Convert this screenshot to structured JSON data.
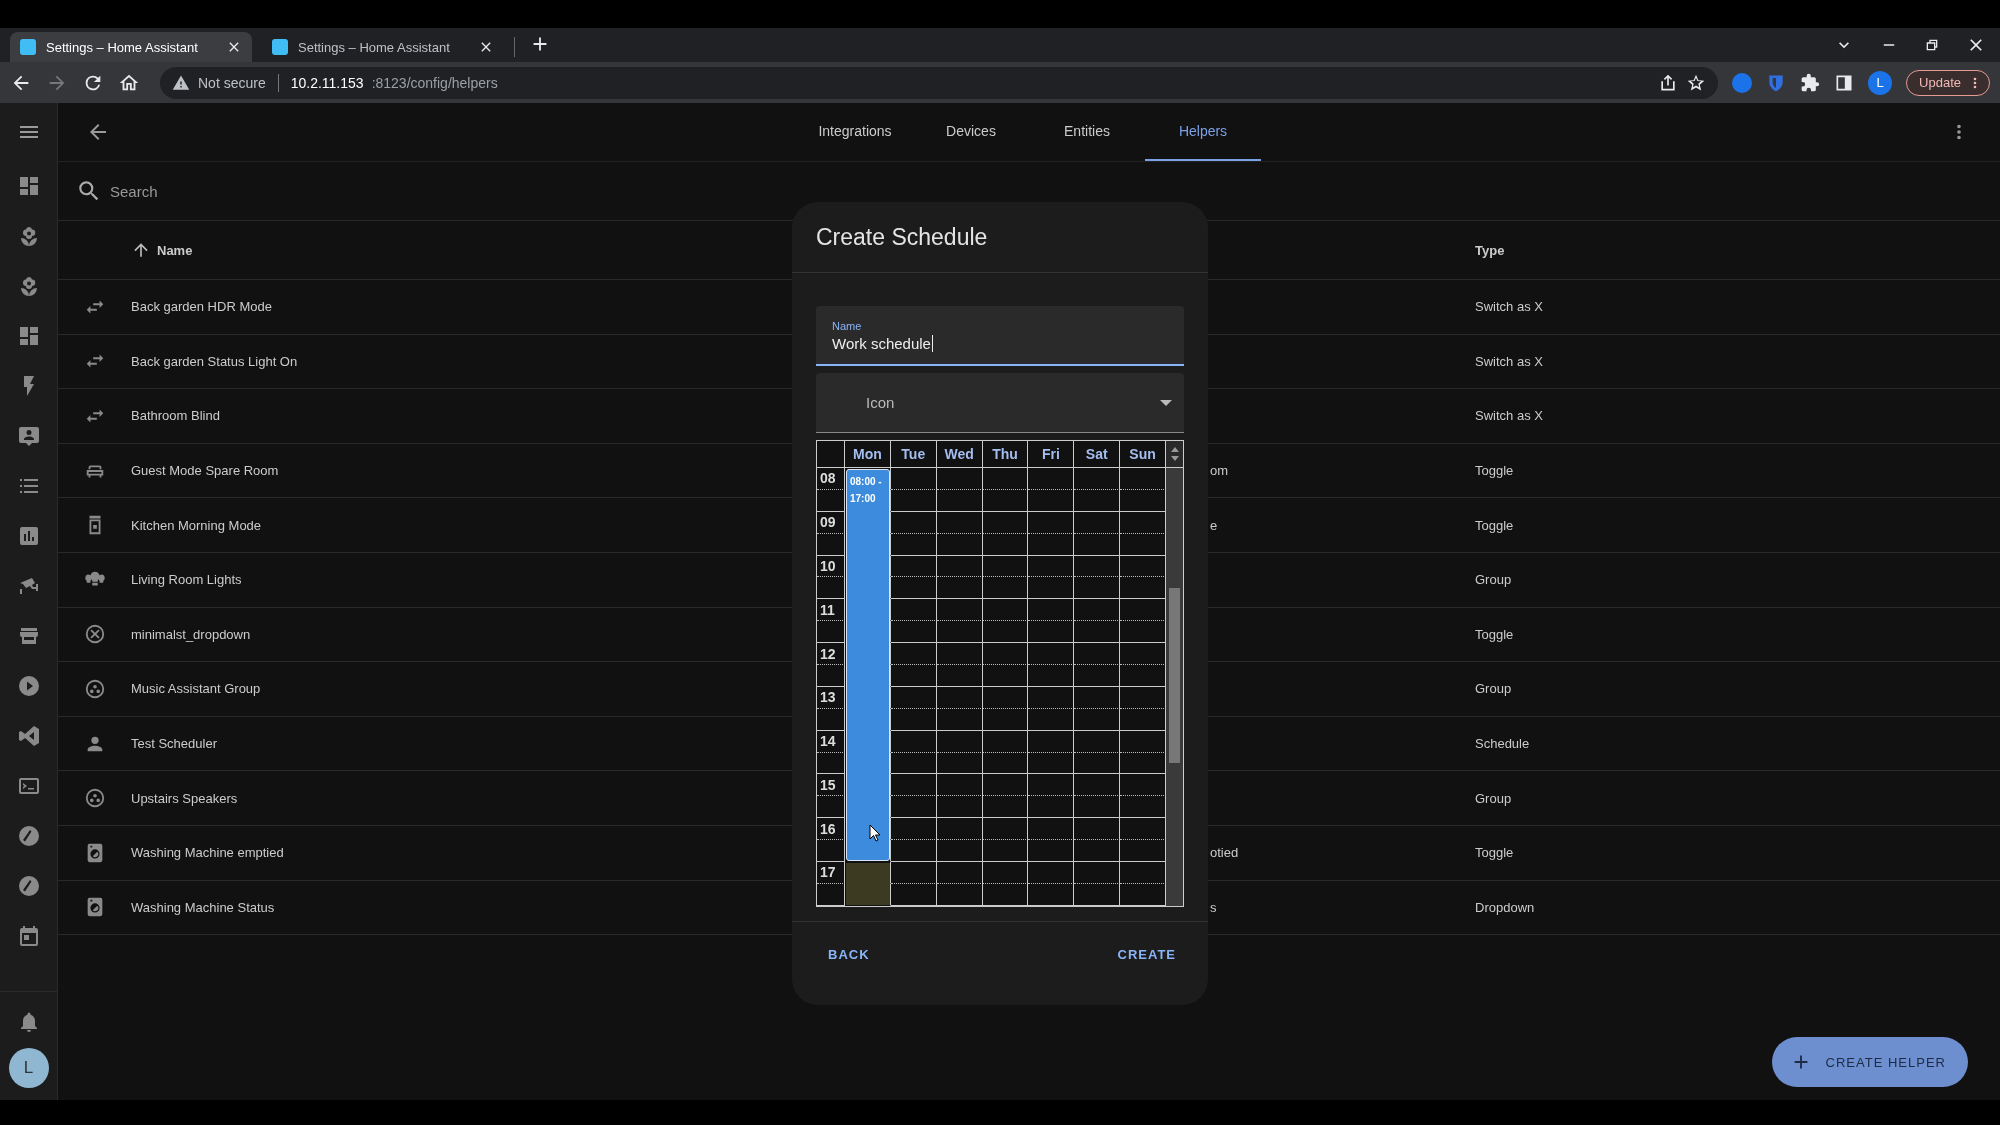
{
  "browser": {
    "tabs": [
      {
        "title": "Settings – Home Assistant",
        "selected": true
      },
      {
        "title": "Settings – Home Assistant",
        "selected": false
      }
    ],
    "security": "Not secure",
    "url_host": "10.2.11.153",
    "url_path": ":8123/config/helpers",
    "profile": "L",
    "update": "Update"
  },
  "app": {
    "tabs": [
      {
        "label": "Integrations",
        "selected": false
      },
      {
        "label": "Devices",
        "selected": false
      },
      {
        "label": "Entities",
        "selected": false
      },
      {
        "label": "Helpers",
        "selected": true
      }
    ],
    "search": {
      "placeholder": "Search"
    },
    "columns": {
      "name": "Name",
      "type": "Type"
    },
    "rows": [
      {
        "name": "Back garden HDR Mode",
        "type": "Switch as X"
      },
      {
        "name": "Back garden Status Light On",
        "type": "Switch as X"
      },
      {
        "name": "Bathroom Blind",
        "type": "Switch as X"
      },
      {
        "name": "Guest Mode Spare Room",
        "column_2": "om",
        "type": "Toggle"
      },
      {
        "name": "Kitchen Morning Mode",
        "column_2": "e",
        "type": "Toggle"
      },
      {
        "name": "Living Room Lights",
        "type": "Group"
      },
      {
        "name": "minimalst_dropdown",
        "type": "Toggle"
      },
      {
        "name": "Music Assistant Group",
        "type": "Group"
      },
      {
        "name": "Test Scheduler",
        "type": "Schedule"
      },
      {
        "name": "Upstairs Speakers",
        "type": "Group"
      },
      {
        "name": "Washing Machine emptied",
        "column_2": "otied",
        "type": "Toggle"
      },
      {
        "name": "Washing Machine Status",
        "column_2": "s",
        "type": "Dropdown"
      }
    ],
    "avatar": "L",
    "fab": "CREATE HELPER"
  },
  "dialog": {
    "title": "Create Schedule",
    "name_field": {
      "label": "Name",
      "value": "Work schedule",
      "focused": true
    },
    "icon_field": {
      "label": "Icon"
    },
    "calendar": {
      "hours": [
        "08",
        "09",
        "10",
        "11",
        "12",
        "13",
        "14",
        "15",
        "16",
        "17"
      ],
      "days": [
        {
          "label": "Mon",
          "events": [
            {
              "kind": "block",
              "label": "08:00 - 17:00"
            },
            {
              "kind": "selection"
            }
          ]
        },
        {
          "label": "Tue"
        },
        {
          "label": "Wed"
        },
        {
          "label": "Thu"
        },
        {
          "label": "Fri"
        },
        {
          "label": "Sat"
        },
        {
          "label": "Sun"
        }
      ]
    },
    "actions": [
      "BACK",
      "CREATE"
    ]
  }
}
